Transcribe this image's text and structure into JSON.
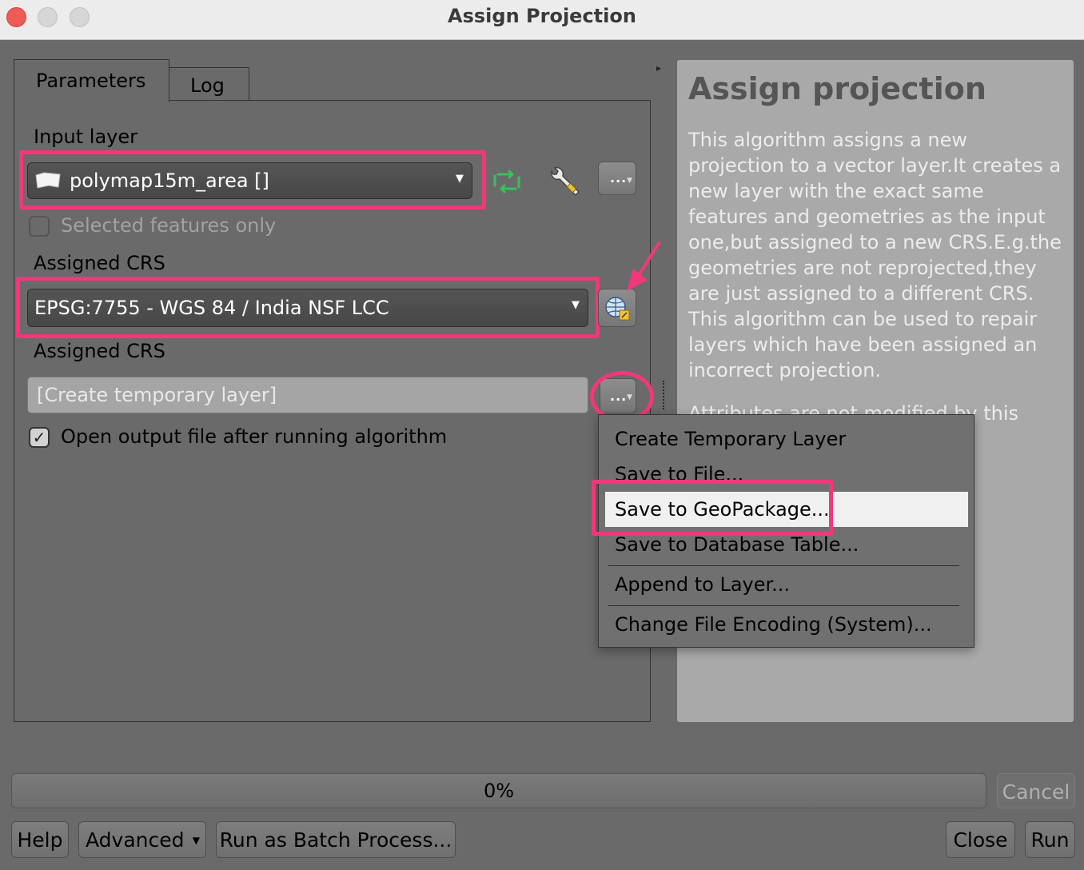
{
  "window": {
    "title": "Assign Projection"
  },
  "tabs": [
    {
      "label": "Parameters"
    },
    {
      "label": "Log"
    }
  ],
  "params": {
    "input_layer_label": "Input layer",
    "input_layer_value": "polymap15m_area []",
    "selected_only_label": "Selected features only",
    "assigned_crs_label": "Assigned CRS",
    "assigned_crs_value": "EPSG:7755 - WGS 84 / India NSF LCC",
    "output_label": "Assigned CRS",
    "output_placeholder": "[Create temporary layer]",
    "open_output_label": "Open output file after running algorithm",
    "open_output_checked": true,
    "selected_only_checked": false,
    "more_button_label": "..."
  },
  "output_menu": {
    "items": [
      {
        "label": "Create Temporary Layer"
      },
      {
        "label": "Save to File..."
      },
      {
        "label": "Save to GeoPackage..."
      },
      {
        "label": "Save to Database Table..."
      },
      {
        "label": "Append to Layer..."
      },
      {
        "label": "Change File Encoding (System)..."
      }
    ],
    "selected": "Save to GeoPackage..."
  },
  "help": {
    "title": "Assign projection",
    "body": "This algorithm assigns a new projection to a vector layer.It creates a new layer with the exact same features and geometries as the input one,but assigned to a new CRS.E.g.the geometries are not reprojected,they are just assigned to a different CRS. This algorithm can be used to repair layers which have been assigned an incorrect projection.",
    "extra": "Attributes are not modified by this"
  },
  "progress": {
    "text": "0%",
    "value": 0
  },
  "buttons": {
    "cancel": "Cancel",
    "help": "Help",
    "advanced": "Advanced",
    "batch": "Run as Batch Process...",
    "close": "Close",
    "run": "Run"
  },
  "colors": {
    "highlight": "#f2377a",
    "panel": "#6a6a6a",
    "help_bg": "#a9a9a9"
  },
  "icons": [
    "layer-polygon-icon",
    "iterate-icon",
    "wrench-icon",
    "crs-globe-icon",
    "annotation-arrow-icon"
  ]
}
